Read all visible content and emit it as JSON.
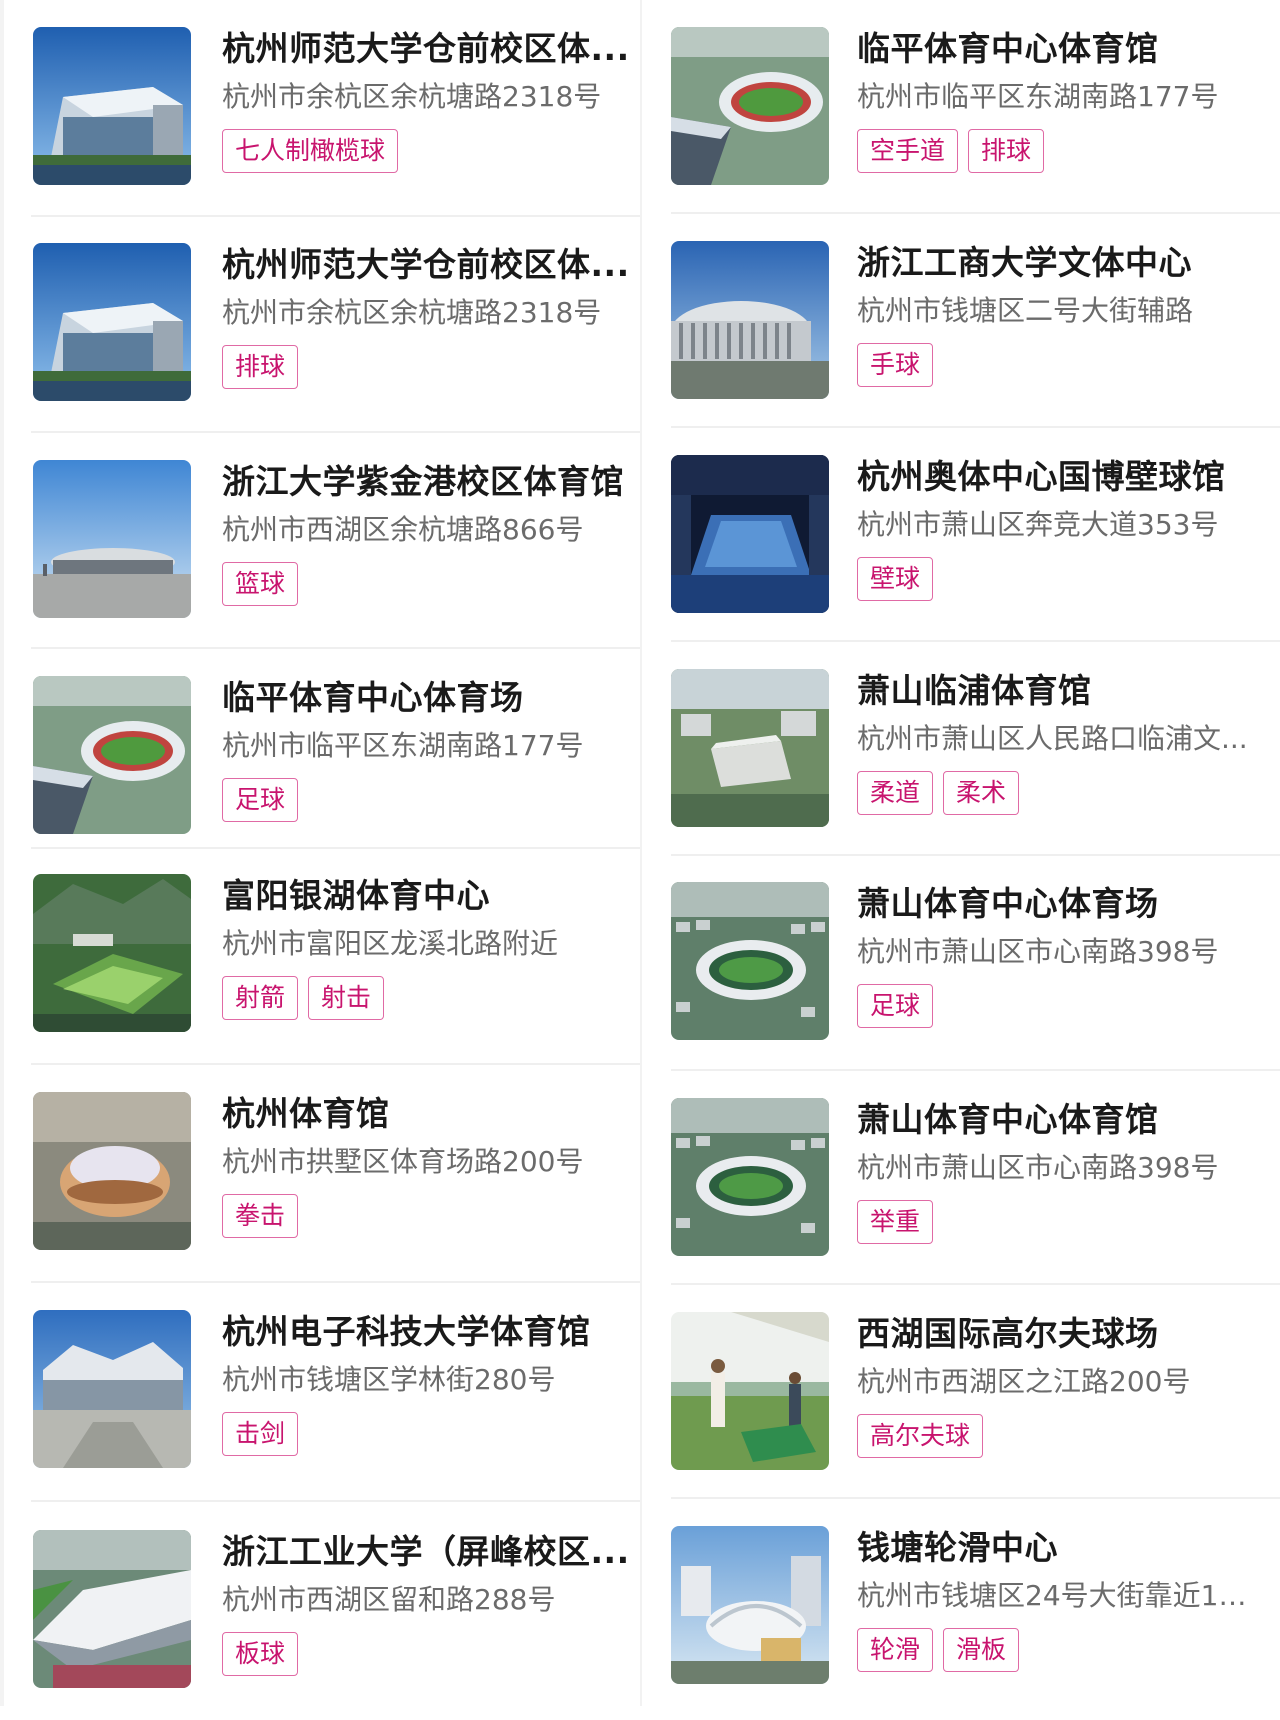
{
  "colors": {
    "tag_border": "#e06aa5",
    "tag_text": "#c8146e",
    "title": "#1a1a1a",
    "address": "#6b6b6b"
  },
  "left": [
    {
      "title": "杭州师范大学仓前校区体...",
      "address": "杭州市余杭区余杭塘路2318号",
      "tags": [
        "七人制橄榄球"
      ],
      "thumb": "modern-gym-building"
    },
    {
      "title": "杭州师范大学仓前校区体...",
      "address": "杭州市余杭区余杭塘路2318号",
      "tags": [
        "排球"
      ],
      "thumb": "modern-gym-building"
    },
    {
      "title": "浙江大学紫金港校区体育馆",
      "address": "杭州市西湖区余杭塘路866号",
      "tags": [
        "篮球"
      ],
      "thumb": "dome-gym"
    },
    {
      "title": "临平体育中心体育场",
      "address": "杭州市临平区东湖南路177号",
      "tags": [
        "足球"
      ],
      "thumb": "stadium-aerial"
    },
    {
      "title": "富阳银湖体育中心",
      "address": "杭州市富阳区龙溪北路附近",
      "tags": [
        "射箭",
        "射击"
      ],
      "thumb": "mountain-sports-center"
    },
    {
      "title": "杭州体育馆",
      "address": "杭州市拱墅区体育场路200号",
      "tags": [
        "拳击"
      ],
      "thumb": "round-arena"
    },
    {
      "title": "杭州电子科技大学体育馆",
      "address": "杭州市钱塘区学林街280号",
      "tags": [
        "击剑"
      ],
      "thumb": "canopy-gym"
    },
    {
      "title": "浙江工业大学（屏峰校区...",
      "address": "杭州市西湖区留和路288号",
      "tags": [
        "板球"
      ],
      "thumb": "white-roof-field"
    }
  ],
  "right": [
    {
      "title": "临平体育中心体育馆",
      "address": "杭州市临平区东湖南路177号",
      "tags": [
        "空手道",
        "排球"
      ],
      "thumb": "stadium-aerial"
    },
    {
      "title": "浙江工商大学文体中心",
      "address": "杭州市钱塘区二号大街辅路",
      "tags": [
        "手球"
      ],
      "thumb": "colonnade-arena"
    },
    {
      "title": "杭州奥体中心国博壁球馆",
      "address": "杭州市萧山区奔竞大道353号",
      "tags": [
        "壁球"
      ],
      "thumb": "indoor-court"
    },
    {
      "title": "萧山临浦体育馆",
      "address": "杭州市萧山区人民路口临浦文...",
      "tags": [
        "柔道",
        "柔术"
      ],
      "thumb": "town-gym"
    },
    {
      "title": "萧山体育中心体育场",
      "address": "杭州市萧山区市心南路398号",
      "tags": [
        "足球"
      ],
      "thumb": "city-stadium"
    },
    {
      "title": "萧山体育中心体育馆",
      "address": "杭州市萧山区市心南路398号",
      "tags": [
        "举重"
      ],
      "thumb": "city-stadium"
    },
    {
      "title": "西湖国际高尔夫球场",
      "address": "杭州市西湖区之江路200号",
      "tags": [
        "高尔夫球"
      ],
      "thumb": "golf-range"
    },
    {
      "title": "钱塘轮滑中心",
      "address": "杭州市钱塘区24号大街靠近15...",
      "tags": [
        "轮滑",
        "滑板"
      ],
      "thumb": "skate-center"
    }
  ]
}
